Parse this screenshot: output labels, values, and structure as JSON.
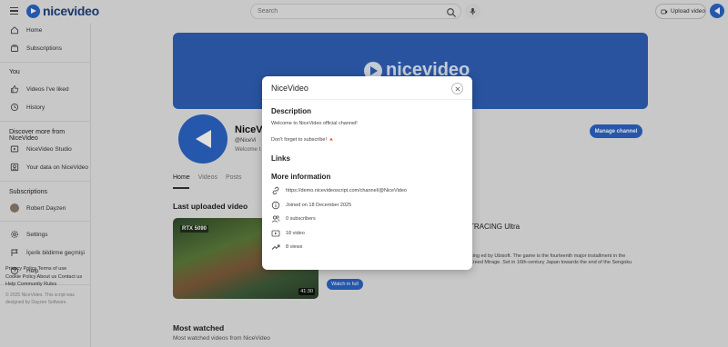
{
  "header": {
    "logo_text": "nicevideo",
    "search_placeholder": "Search",
    "upload_label": "Upload video"
  },
  "sidebar": {
    "nav": [
      {
        "label": "Home",
        "icon": "home-icon"
      },
      {
        "label": "Subscriptions",
        "icon": "subscriptions-icon"
      }
    ],
    "you_heading": "You",
    "you_items": [
      {
        "label": "Videos I've liked",
        "icon": "thumbs-up-icon"
      },
      {
        "label": "History",
        "icon": "history-icon"
      }
    ],
    "discover_heading": "Discover more from NiceVideo",
    "discover_items": [
      {
        "label": "NiceVideo Studio",
        "icon": "studio-icon"
      },
      {
        "label": "Your data on NiceVideo",
        "icon": "account-icon"
      }
    ],
    "subs_heading": "Subscriptions",
    "subscriptions": [
      {
        "label": "Robert Dayzen"
      }
    ],
    "bottom_items": [
      {
        "label": "Settings",
        "icon": "gear-icon"
      },
      {
        "label": "İçerik bildirme geçmişi",
        "icon": "flag-icon"
      },
      {
        "label": "Help",
        "icon": "help-icon"
      }
    ],
    "footer_line1": "Privacy Policy  Terms of use",
    "footer_line2": "Cookie Policy  About us  Contact us",
    "footer_line3": "Help  Community Rules",
    "copyright": "© 2025 NiceVideo. This script was designed by Dayzen Software."
  },
  "channel": {
    "banner_logo": "nicevideo",
    "name": "NiceVi",
    "handle": "@NiceVi",
    "welcome": "Welcome t",
    "manage_label": "Manage channel",
    "tabs": [
      "Home",
      "Videos",
      "Posts"
    ]
  },
  "last_uploaded": {
    "title": "Last uploaded video",
    "thumb_badge": "RTX 5090",
    "duration": "41:30",
    "video_title": "Y GORGEOUS (RTX 5090) INSANE RAY-TRACING Ultra",
    "video_title_cont": "",
    "description": "eplays... ▶About Game... Assassin's Creed Shadows is an upcoming ed by Ubisoft. The game is the fourteenth major installment in the Assassin's Creed series and the successor to 2023's Assassin's Creed Mirage. Set in 16th-century Japan towards the end of the Sengoku",
    "watch_label": "Watch in full"
  },
  "most_watched": {
    "title": "Most watched",
    "subtitle": "Most watched videos from NiceVideo"
  },
  "modal": {
    "title": "NiceVideo",
    "description_heading": "Description",
    "description_line1": "Welcome to NiceVideo official channel!",
    "description_line2": "Don't forget to subscribe! 🔺",
    "links_heading": "Links",
    "more_heading": "More information",
    "info": [
      {
        "icon": "link-icon",
        "text": "https://demo.nicevideoscript.com/channel/@NiceVideo"
      },
      {
        "icon": "info-icon",
        "text": "Joined on 18 December 2025"
      },
      {
        "icon": "subscribers-icon",
        "text": "0 subscribers"
      },
      {
        "icon": "video-icon",
        "text": "18 video"
      },
      {
        "icon": "trending-icon",
        "text": "8 views"
      }
    ]
  },
  "colors": {
    "accent": "#2b63c4",
    "banner": "#2f5fb5",
    "background": "#e4e4e4"
  }
}
